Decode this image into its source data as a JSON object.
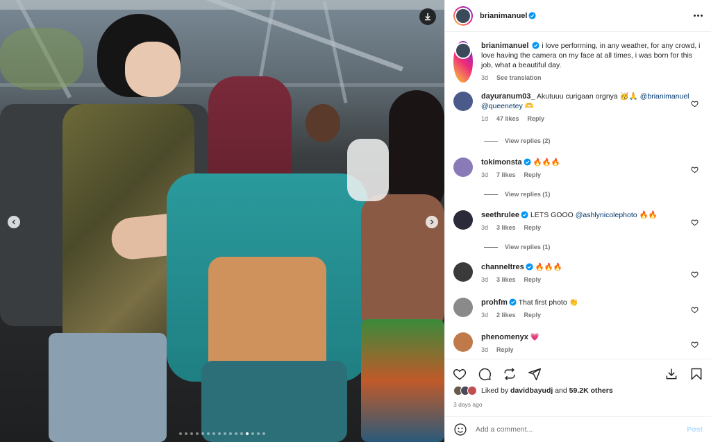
{
  "post": {
    "author": "brianimanuel",
    "author_verified": true,
    "caption": "i love performing, in any weather, for any crowd, i love having the camera on my face at all times, i was born for this job, what a beautiful day.",
    "caption_time": "3d",
    "see_translation": "See translation",
    "liked_by_prefix": "Liked by",
    "liked_by_user": "davidbayudj",
    "liked_by_and": "and",
    "liked_by_others": "59.2K others",
    "posted_ago": "3 days ago",
    "comment_placeholder": "Add a comment...",
    "post_label": "Post",
    "carousel": {
      "total": 16,
      "active": 13
    }
  },
  "comments": [
    {
      "user": "dayuranum03_",
      "verified": false,
      "text": "Akutuuu curigaan orgnya 🥳🙏",
      "mentions": "@brianimanuel @queenetey",
      "emoji_after": "🫶",
      "time": "1d",
      "likes": "47 likes",
      "reply": "Reply",
      "view_replies": "View replies (2)",
      "avatar_color": "#4a5a8a"
    },
    {
      "user": "tokimonsta",
      "verified": true,
      "text": "🔥🔥🔥",
      "time": "3d",
      "likes": "7 likes",
      "reply": "Reply",
      "view_replies": "View replies (1)",
      "avatar_color": "#8a7ab8"
    },
    {
      "user": "seethrulee",
      "verified": true,
      "text": "LETS GOOO",
      "mentions": "@ashlynicolephoto",
      "emoji_after": "🔥🔥",
      "time": "3d",
      "likes": "3 likes",
      "reply": "Reply",
      "view_replies": "View replies (1)",
      "avatar_color": "#2a2a3a"
    },
    {
      "user": "channeltres",
      "verified": true,
      "text": "🔥🔥🔥",
      "time": "3d",
      "likes": "3 likes",
      "reply": "Reply",
      "avatar_color": "#3a3a3a"
    },
    {
      "user": "prohfm",
      "verified": true,
      "text": "That first photo 👏",
      "time": "3d",
      "likes": "2 likes",
      "reply": "Reply",
      "avatar_color": "#8a8a8a"
    },
    {
      "user": "phenomenyx",
      "verified": false,
      "text": "💗",
      "time": "3d",
      "reply": "Reply",
      "avatar_color": "#c07a4a"
    }
  ],
  "colors": {
    "accent": "#0095f6",
    "mention": "#00376b",
    "muted": "#737373",
    "post_disabled": "#b3dbff"
  },
  "icons": [
    "download-icon",
    "chevron-left-icon",
    "chevron-right-icon",
    "verified-icon",
    "more-icon",
    "heart-icon",
    "comment-icon",
    "share-icon",
    "send-icon",
    "save-icon",
    "emoji-icon"
  ]
}
